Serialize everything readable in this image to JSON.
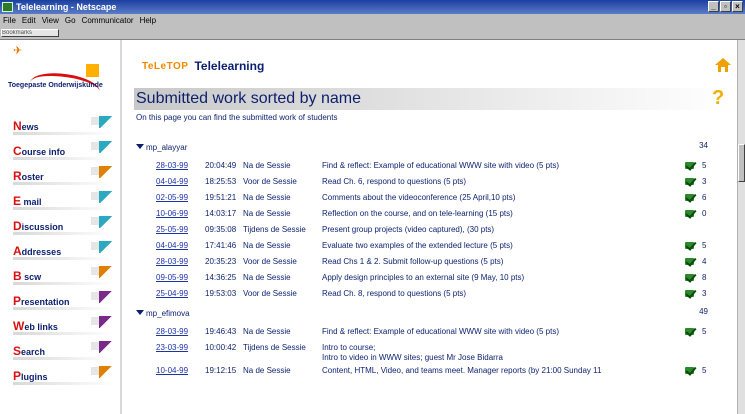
{
  "window": {
    "title": "Telelearning - Netscape",
    "controls": [
      "_",
      "▫",
      "×"
    ]
  },
  "menu": [
    "File",
    "Edit",
    "View",
    "Go",
    "Communicator",
    "Help"
  ],
  "toolbar_grip": "Bookmarks",
  "logo": {
    "left_word": "Toegepaste",
    "right_word": "Onderwijskunde"
  },
  "nav": [
    {
      "cap": "N",
      "rest": "ews",
      "flag_color": "#2aa9c0"
    },
    {
      "cap": "C",
      "rest": "ourse info",
      "flag_color": "#2aa9c0"
    },
    {
      "cap": "R",
      "rest": "oster",
      "flag_color": "#e08000"
    },
    {
      "cap": "E",
      "rest": " mail",
      "flag_color": "#2aa9c0"
    },
    {
      "cap": "D",
      "rest": "iscussion",
      "flag_color": "#2aa9c0"
    },
    {
      "cap": "A",
      "rest": "ddresses",
      "flag_color": "#2aa9c0"
    },
    {
      "cap": "B",
      "rest": " scw",
      "flag_color": "#e08000"
    },
    {
      "cap": "P",
      "rest": "resentation",
      "flag_color": "#7a2a8a"
    },
    {
      "cap": "W",
      "rest": "eb links",
      "flag_color": "#7a2a8a"
    },
    {
      "cap": "S",
      "rest": "earch",
      "flag_color": "#7a2a8a"
    },
    {
      "cap": "P",
      "rest": "lugins",
      "flag_color": "#e08000"
    }
  ],
  "brand": {
    "logo_text": "TeLeTOP",
    "title": "Telelearning"
  },
  "page": {
    "title": "Submitted work sorted by name",
    "intro": "On this page you can find the submitted work of students"
  },
  "groups": [
    {
      "name": "mp_alayyar",
      "total": "34",
      "rows": [
        {
          "date": "28-03-99",
          "time": "20:04:49",
          "phase": "Na de Sessie",
          "task": "Find & reflect: Example of educational WWW site with video (5 pts)",
          "checked": true,
          "score": "5"
        },
        {
          "date": "04-04-99",
          "time": "18:25:53",
          "phase": "Voor de Sessie",
          "task": "Read Ch. 6, respond to questions (5 pts)",
          "checked": true,
          "score": "3"
        },
        {
          "date": "02-05-99",
          "time": "19:51:21",
          "phase": "Na de Sessie",
          "task": "Comments about the videoconference (25 April,10 pts)",
          "checked": true,
          "score": "6"
        },
        {
          "date": "10-06-99",
          "time": "14:03:17",
          "phase": "Na de Sessie",
          "task": "Reflection on the course, and on tele-learning (15 pts)",
          "checked": true,
          "score": "0"
        },
        {
          "date": "25-05-99",
          "time": "09:35:08",
          "phase": "Tijdens de Sessie",
          "task": "Present group projects (video captured), (30 pts)",
          "checked": false,
          "score": ""
        },
        {
          "date": "04-04-99",
          "time": "17:41:46",
          "phase": "Na de Sessie",
          "task": "Evaluate two examples of the extended lecture (5 pts)",
          "checked": true,
          "score": "5"
        },
        {
          "date": "28-03-99",
          "time": "20:35:23",
          "phase": "Voor de Sessie",
          "task": "Read Chs 1 & 2. Submit follow-up questions (5 pts)",
          "checked": true,
          "score": "4"
        },
        {
          "date": "09-05-99",
          "time": "14:36:25",
          "phase": "Na de Sessie",
          "task": "Apply design principles to an external site (9 May, 10 pts)",
          "checked": true,
          "score": "8"
        },
        {
          "date": "25-04-99",
          "time": "19:53:03",
          "phase": "Voor de Sessie",
          "task": "Read Ch. 8, respond to questions (5 pts)",
          "checked": true,
          "score": "3"
        }
      ]
    },
    {
      "name": "mp_efimova",
      "total": "49",
      "rows": [
        {
          "date": "28-03-99",
          "time": "19:46:43",
          "phase": "Na de Sessie",
          "task": "Find & reflect: Example of educational WWW site with video (5 pts)",
          "checked": true,
          "score": "5"
        },
        {
          "date": "23-03-99",
          "time": "10:00:42",
          "phase": "Tijdens de Sessie",
          "task": "Intro to course;",
          "task2": "Intro to video in WWW sites; guest Mr Jose Bidarra",
          "checked": false,
          "score": ""
        },
        {
          "date": "10-04-99",
          "time": "19:12:15",
          "phase": "Na de Sessie",
          "task": "Content, HTML, Video, and teams meet. Manager reports (by 21:00 Sunday 11",
          "checked": true,
          "score": "5"
        }
      ]
    }
  ],
  "colors": {
    "navy": "#0b1f6e",
    "link": "#1c34a8",
    "accent_orange": "#f08a00",
    "logo_red": "#d81010",
    "check_green": "#2b8a2b"
  }
}
